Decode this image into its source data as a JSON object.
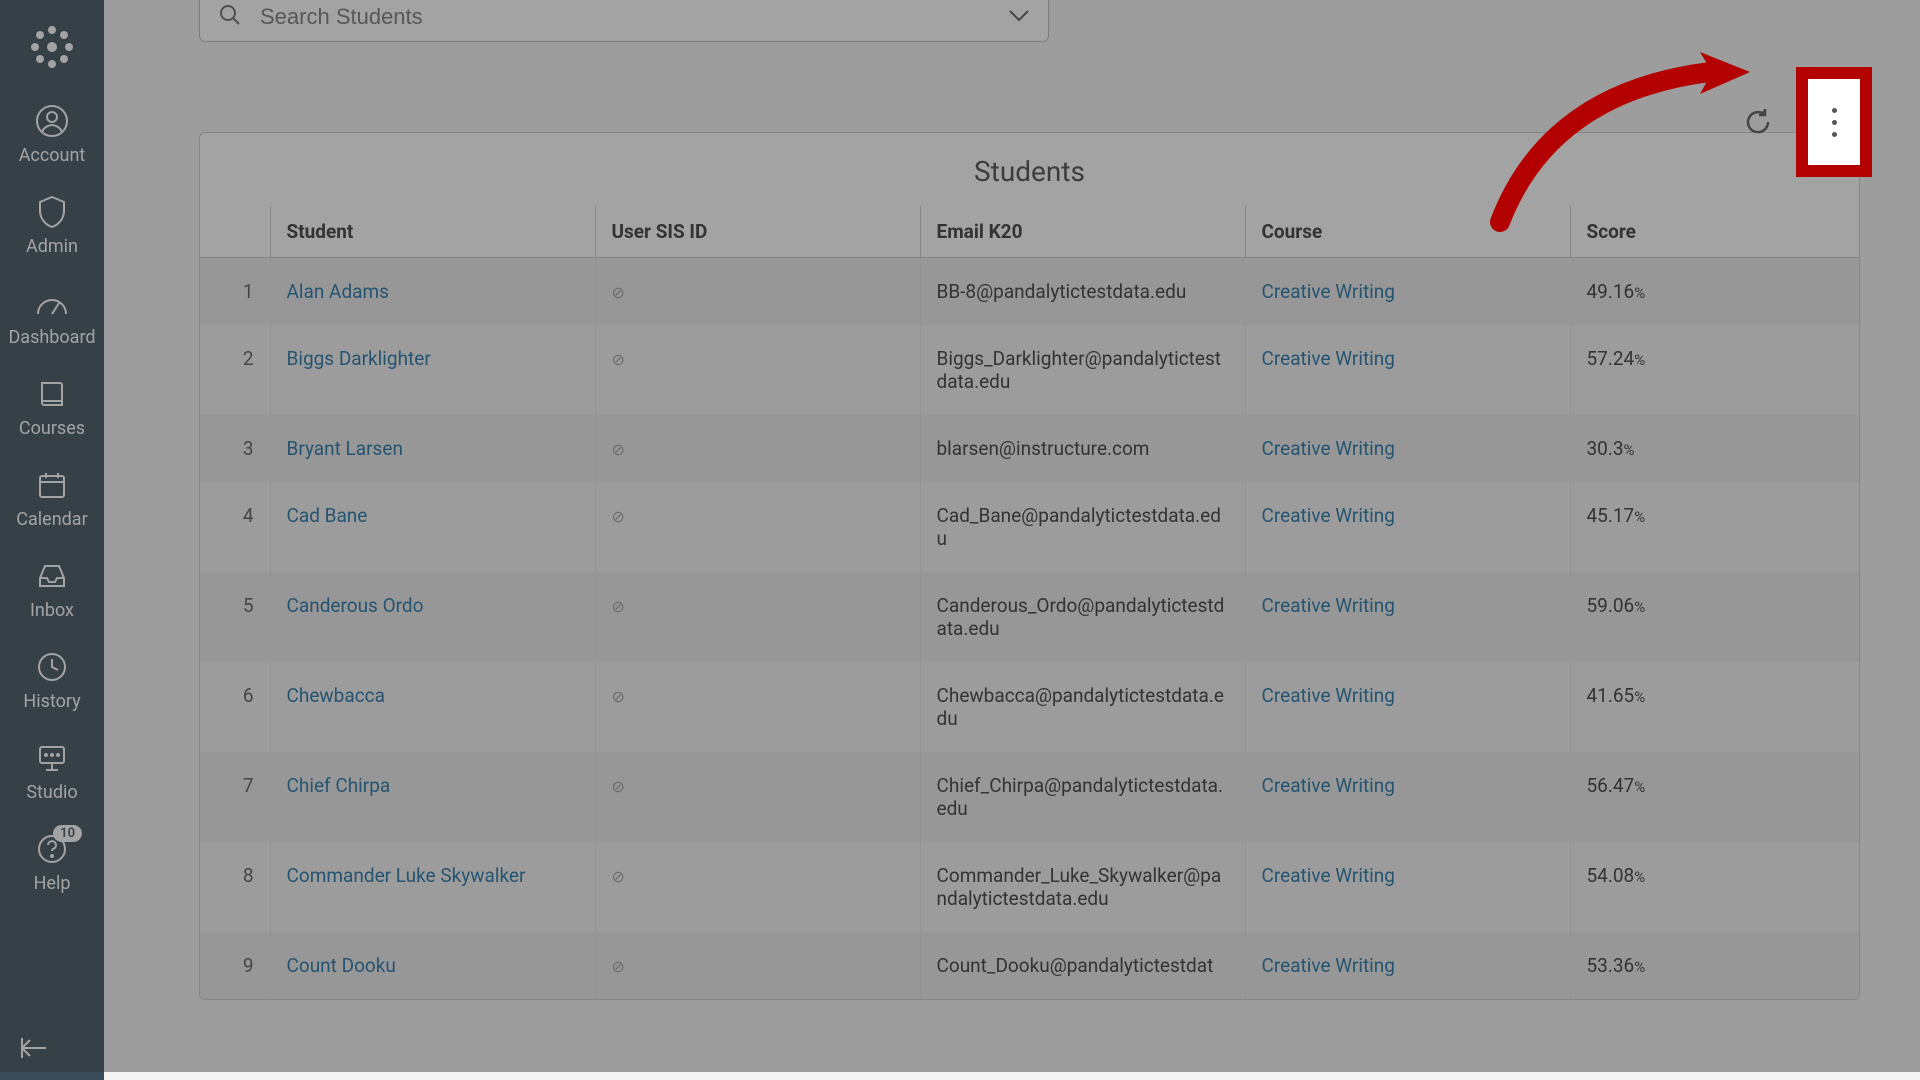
{
  "sidebar": {
    "items": [
      {
        "label": "Account",
        "icon": "user-circle"
      },
      {
        "label": "Admin",
        "icon": "shield"
      },
      {
        "label": "Dashboard",
        "icon": "gauge"
      },
      {
        "label": "Courses",
        "icon": "book"
      },
      {
        "label": "Calendar",
        "icon": "calendar"
      },
      {
        "label": "Inbox",
        "icon": "inbox"
      },
      {
        "label": "History",
        "icon": "clock"
      },
      {
        "label": "Studio",
        "icon": "studio"
      },
      {
        "label": "Help",
        "icon": "help",
        "badge": "10"
      }
    ]
  },
  "search": {
    "placeholder": "Search Students"
  },
  "table": {
    "title": "Students",
    "headers": {
      "student": "Student",
      "sis": "User SIS ID",
      "email": "Email K20",
      "course": "Course",
      "score": "Score"
    },
    "rows": [
      {
        "n": "1",
        "student": "Alan Adams",
        "sis_empty": true,
        "email": "BB-8@pandalytictestdata.edu",
        "course": "Creative Writing",
        "score": "49.16",
        "unit": "%"
      },
      {
        "n": "2",
        "student": "Biggs Darklighter",
        "sis_empty": true,
        "email": "Biggs_Darklighter@pandalytictestdata.edu",
        "course": "Creative Writing",
        "score": "57.24",
        "unit": "%"
      },
      {
        "n": "3",
        "student": "Bryant Larsen",
        "sis_empty": true,
        "email": "blarsen@instructure.com",
        "course": "Creative Writing",
        "score": "30.3",
        "unit": "%"
      },
      {
        "n": "4",
        "student": "Cad Bane",
        "sis_empty": true,
        "email": "Cad_Bane@pandalytictestdata.edu",
        "course": "Creative Writing",
        "score": "45.17",
        "unit": "%"
      },
      {
        "n": "5",
        "student": "Canderous Ordo",
        "sis_empty": true,
        "email": "Canderous_Ordo@pandalytictestdata.edu",
        "course": "Creative Writing",
        "score": "59.06",
        "unit": "%"
      },
      {
        "n": "6",
        "student": "Chewbacca",
        "sis_empty": true,
        "email": "Chewbacca@pandalytictestdata.edu",
        "course": "Creative Writing",
        "score": "41.65",
        "unit": "%"
      },
      {
        "n": "7",
        "student": "Chief Chirpa",
        "sis_empty": true,
        "email": "Chief_Chirpa@pandalytictestdata.edu",
        "course": "Creative Writing",
        "score": "56.47",
        "unit": "%"
      },
      {
        "n": "8",
        "student": "Commander Luke Skywalker",
        "sis_empty": true,
        "email": "Commander_Luke_Skywalker@pandalytictestdata.edu",
        "course": "Creative Writing",
        "score": "54.08",
        "unit": "%"
      },
      {
        "n": "9",
        "student": "Count Dooku",
        "sis_empty": true,
        "email": "Count_Dooku@pandalytictestdat",
        "course": "Creative Writing",
        "score": "53.36",
        "unit": "%"
      }
    ]
  }
}
